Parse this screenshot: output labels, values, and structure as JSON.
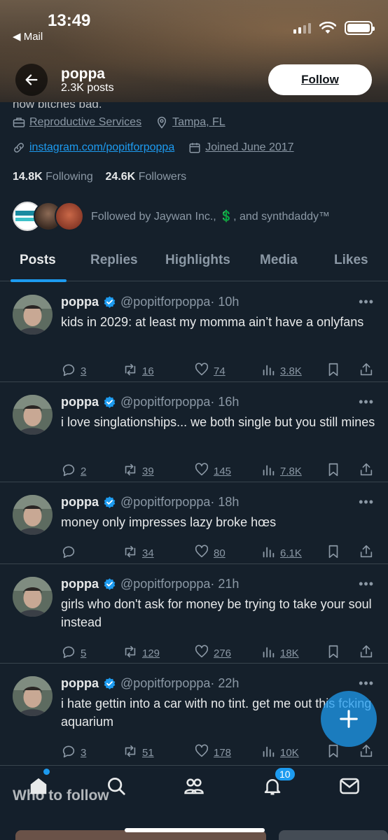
{
  "status_bar": {
    "time": "13:49",
    "back_label": "◀ Mail"
  },
  "header": {
    "name": "poppa",
    "posts_count": "2.3K posts",
    "follow_label": "Follow",
    "bio_peek": "now bitches bad."
  },
  "profile": {
    "category": "Reproductive Services",
    "location": "Tampa, FL",
    "link": "instagram.com/popitforpoppa",
    "joined": "Joined June 2017",
    "following_count": "14.8K",
    "following_label": "Following",
    "followers_count": "24.6K",
    "followers_label": "Followers",
    "followed_by": "Followed by Jaywan Inc., 💲, and synthdaddy™"
  },
  "tabs": [
    "Posts",
    "Replies",
    "Highlights",
    "Media",
    "Likes"
  ],
  "posts": [
    {
      "name": "poppa",
      "handle": "@popitforpoppa",
      "time": "· 10h",
      "text": "kids in 2029: at least my momma ain’t have a onlyfans",
      "replies": "3",
      "reposts": "16",
      "likes": "74",
      "views": "3.8K"
    },
    {
      "name": "poppa",
      "handle": "@popitforpoppa",
      "time": "· 16h",
      "text": "i love singlationships... we both single but you still mines",
      "replies": "2",
      "reposts": "39",
      "likes": "145",
      "views": "7.8K"
    },
    {
      "name": "poppa",
      "handle": "@popitforpoppa",
      "time": "· 18h",
      "text": "money only impresses lazy broke hœs",
      "replies": "",
      "reposts": "34",
      "likes": "80",
      "views": "6.1K"
    },
    {
      "name": "poppa",
      "handle": "@popitforpoppa",
      "time": "· 21h",
      "text": "girls who don't ask for money be trying to take your soul instead",
      "replies": "5",
      "reposts": "129",
      "likes": "276",
      "views": "18K"
    },
    {
      "name": "poppa",
      "handle": "@popitforpoppa",
      "time": "· 22h",
      "text": "i hate gettin into a car with no tint. get me out this fcking aquarium",
      "replies": "3",
      "reposts": "51",
      "likes": "178",
      "views": "10K"
    }
  ],
  "bottom_nav": {
    "notifications_badge": "10",
    "who_to_follow": "Who to follow"
  },
  "colors": {
    "background": "#15202b",
    "accent": "#1d9bf0",
    "muted": "#8b98a5"
  }
}
